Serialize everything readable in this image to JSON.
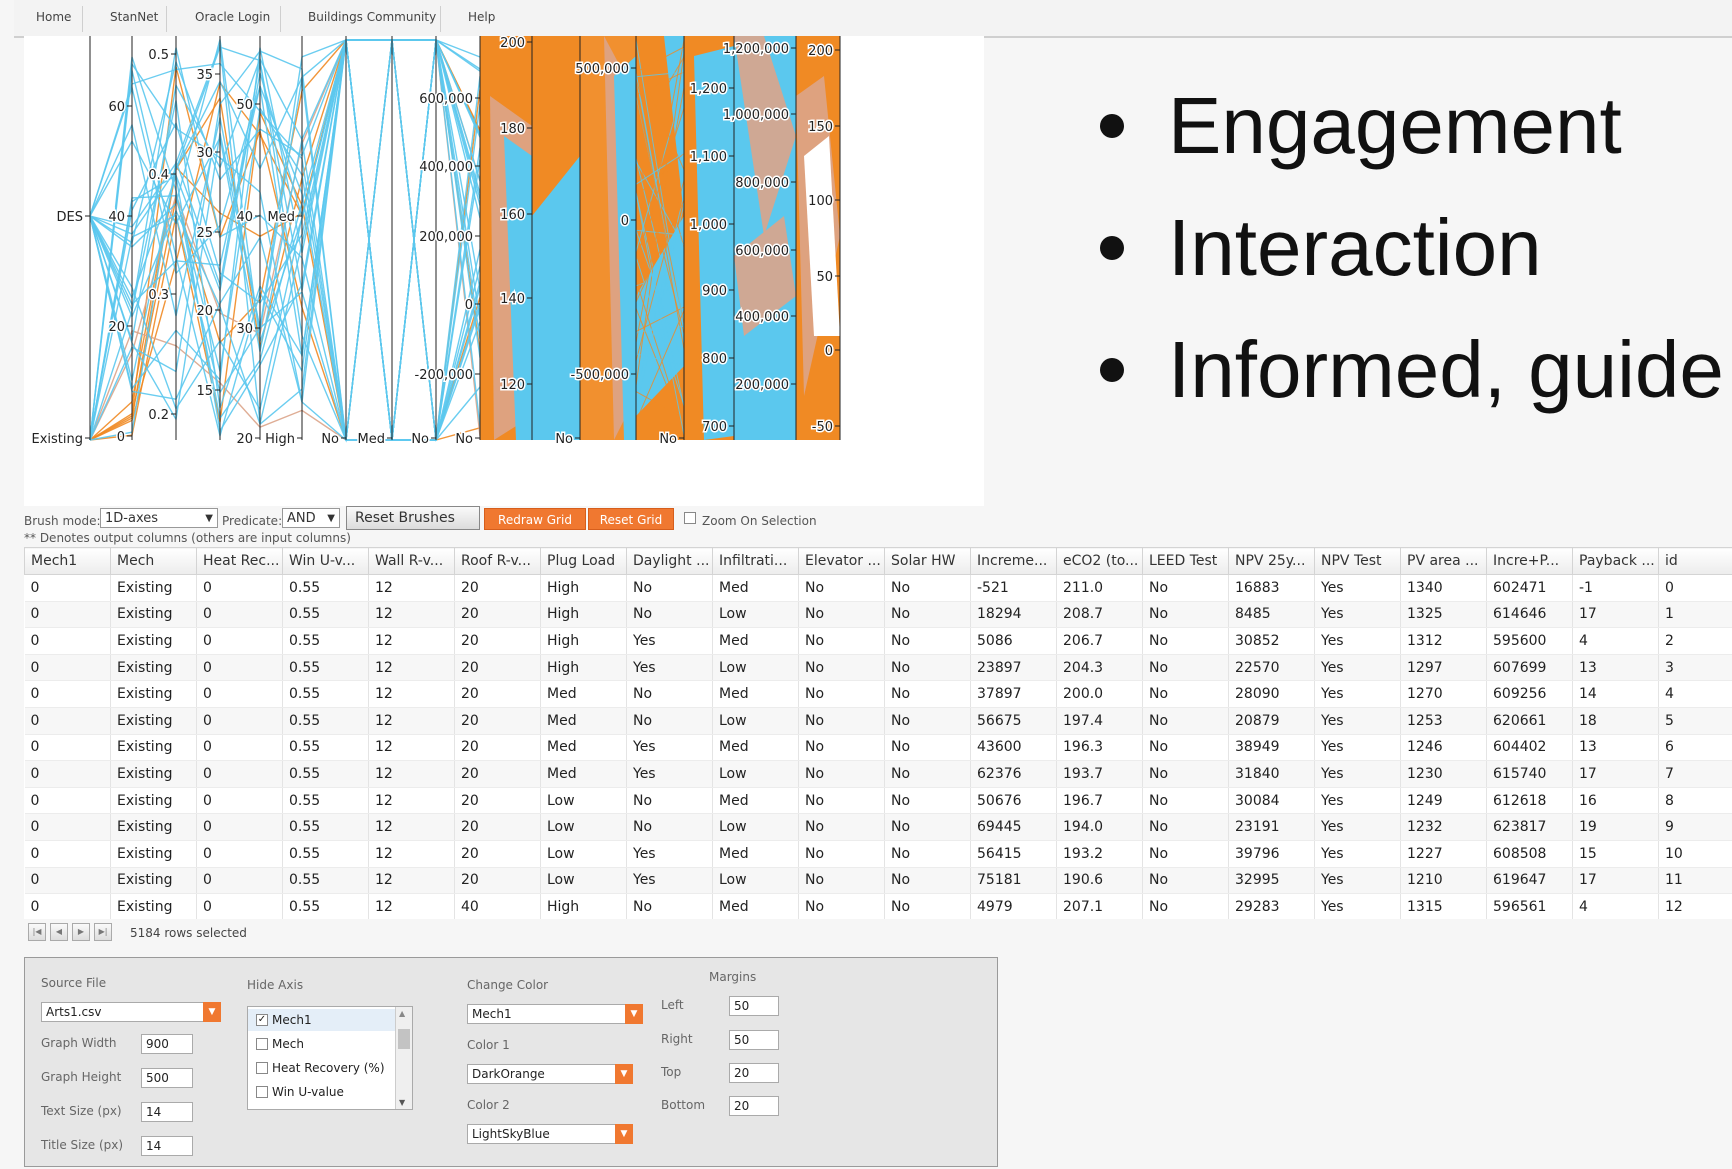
{
  "nav": {
    "items": [
      "Home",
      "StanNet",
      "Oracle Login",
      "Buildings Community",
      "Help"
    ]
  },
  "colors": {
    "orange": "#f08a24",
    "blue": "#5bc8ee",
    "tan": "#dca48a",
    "button_orange": "#f07830"
  },
  "chart": {
    "axes": [
      {
        "ticks": [
          {
            "label": "DES"
          },
          {
            "label": "Existing"
          }
        ]
      },
      {
        "ticks": [
          {
            "label": "60"
          },
          {
            "label": "40"
          },
          {
            "label": "20"
          },
          {
            "label": "0"
          }
        ]
      },
      {
        "ticks": [
          {
            "label": "0.5"
          },
          {
            "label": "0.4"
          },
          {
            "label": "0.3"
          },
          {
            "label": "0.2"
          }
        ]
      },
      {
        "ticks": [
          {
            "label": "35"
          },
          {
            "label": "30"
          },
          {
            "label": "25"
          },
          {
            "label": "20"
          },
          {
            "label": "15"
          }
        ]
      },
      {
        "ticks": [
          {
            "label": "50"
          },
          {
            "label": "40"
          },
          {
            "label": "30"
          },
          {
            "label": "20"
          }
        ]
      },
      {
        "ticks": [
          {
            "label": "Med"
          },
          {
            "label": "High"
          }
        ]
      },
      {
        "ticks": [
          {
            "label": "No"
          }
        ]
      },
      {
        "ticks": [
          {
            "label": "Med"
          }
        ]
      },
      {
        "ticks": [
          {
            "label": "No"
          }
        ]
      },
      {
        "ticks": [
          {
            "label": "600,000"
          },
          {
            "label": "400,000"
          },
          {
            "label": "200,000"
          },
          {
            "label": "0"
          },
          {
            "label": "-200,000"
          },
          {
            "label": "No"
          }
        ]
      },
      {
        "ticks": [
          {
            "label": "200"
          },
          {
            "label": "180"
          },
          {
            "label": "160"
          },
          {
            "label": "140"
          },
          {
            "label": "120"
          }
        ]
      },
      {
        "ticks": [
          {
            "label": "No"
          }
        ]
      },
      {
        "ticks": [
          {
            "label": "500,000"
          },
          {
            "label": "0"
          },
          {
            "label": "-500,000"
          }
        ]
      },
      {
        "ticks": [
          {
            "label": "No"
          }
        ]
      },
      {
        "ticks": [
          {
            "label": "1,200"
          },
          {
            "label": "1,100"
          },
          {
            "label": "1,000"
          },
          {
            "label": "900"
          },
          {
            "label": "800"
          },
          {
            "label": "700"
          }
        ]
      },
      {
        "ticks": [
          {
            "label": "1,200,000"
          },
          {
            "label": "1,000,000"
          },
          {
            "label": "800,000"
          },
          {
            "label": "600,000"
          },
          {
            "label": "400,000"
          },
          {
            "label": "200,000"
          }
        ]
      },
      {
        "ticks": [
          {
            "label": "200"
          },
          {
            "label": "150"
          },
          {
            "label": "100"
          },
          {
            "label": "50"
          },
          {
            "label": "0"
          },
          {
            "label": "-50"
          }
        ]
      }
    ]
  },
  "bullets": [
    "Engagement",
    "Interaction",
    "Informed, guide"
  ],
  "toolbar": {
    "brush_mode_label": "Brush mode:",
    "brush_mode_value": "1D-axes",
    "predicate_label": "Predicate:",
    "predicate_value": "AND",
    "reset_brushes": "Reset Brushes",
    "redraw_grid": "Redraw Grid",
    "reset_grid": "Reset Grid",
    "zoom_on_selection": "Zoom On Selection"
  },
  "note": "** Denotes output columns (others are input columns)",
  "grid": {
    "columns": [
      "Mech1",
      "Mech",
      "Heat Rec...",
      "Win U-v...",
      "Wall R-v...",
      "Roof R-v...",
      "Plug Load",
      "Daylight ...",
      "Infiltrati...",
      "Elevator ...",
      "Solar HW",
      "Increme...",
      "eCO2 (to...",
      "LEED Test",
      "NPV 25y...",
      "NPV Test",
      "PV area ...",
      "Incre+P...",
      "Payback ...",
      "id"
    ],
    "rows": [
      [
        "0",
        "Existing",
        "0",
        "0.55",
        "12",
        "20",
        "High",
        "No",
        "Med",
        "No",
        "No",
        "-521",
        "211.0",
        "No",
        "16883",
        "Yes",
        "1340",
        "602471",
        "-1",
        "0"
      ],
      [
        "0",
        "Existing",
        "0",
        "0.55",
        "12",
        "20",
        "High",
        "No",
        "Low",
        "No",
        "No",
        "18294",
        "208.7",
        "No",
        "8485",
        "Yes",
        "1325",
        "614646",
        "17",
        "1"
      ],
      [
        "0",
        "Existing",
        "0",
        "0.55",
        "12",
        "20",
        "High",
        "Yes",
        "Med",
        "No",
        "No",
        "5086",
        "206.7",
        "No",
        "30852",
        "Yes",
        "1312",
        "595600",
        "4",
        "2"
      ],
      [
        "0",
        "Existing",
        "0",
        "0.55",
        "12",
        "20",
        "High",
        "Yes",
        "Low",
        "No",
        "No",
        "23897",
        "204.3",
        "No",
        "22570",
        "Yes",
        "1297",
        "607699",
        "13",
        "3"
      ],
      [
        "0",
        "Existing",
        "0",
        "0.55",
        "12",
        "20",
        "Med",
        "No",
        "Med",
        "No",
        "No",
        "37897",
        "200.0",
        "No",
        "28090",
        "Yes",
        "1270",
        "609256",
        "14",
        "4"
      ],
      [
        "0",
        "Existing",
        "0",
        "0.55",
        "12",
        "20",
        "Med",
        "No",
        "Low",
        "No",
        "No",
        "56675",
        "197.4",
        "No",
        "20879",
        "Yes",
        "1253",
        "620661",
        "18",
        "5"
      ],
      [
        "0",
        "Existing",
        "0",
        "0.55",
        "12",
        "20",
        "Med",
        "Yes",
        "Med",
        "No",
        "No",
        "43600",
        "196.3",
        "No",
        "38949",
        "Yes",
        "1246",
        "604402",
        "13",
        "6"
      ],
      [
        "0",
        "Existing",
        "0",
        "0.55",
        "12",
        "20",
        "Med",
        "Yes",
        "Low",
        "No",
        "No",
        "62376",
        "193.7",
        "No",
        "31840",
        "Yes",
        "1230",
        "615740",
        "17",
        "7"
      ],
      [
        "0",
        "Existing",
        "0",
        "0.55",
        "12",
        "20",
        "Low",
        "No",
        "Med",
        "No",
        "No",
        "50676",
        "196.7",
        "No",
        "30084",
        "Yes",
        "1249",
        "612618",
        "16",
        "8"
      ],
      [
        "0",
        "Existing",
        "0",
        "0.55",
        "12",
        "20",
        "Low",
        "No",
        "Low",
        "No",
        "No",
        "69445",
        "194.0",
        "No",
        "23191",
        "Yes",
        "1232",
        "623817",
        "19",
        "9"
      ],
      [
        "0",
        "Existing",
        "0",
        "0.55",
        "12",
        "20",
        "Low",
        "Yes",
        "Med",
        "No",
        "No",
        "56415",
        "193.2",
        "No",
        "39796",
        "Yes",
        "1227",
        "608508",
        "15",
        "10"
      ],
      [
        "0",
        "Existing",
        "0",
        "0.55",
        "12",
        "20",
        "Low",
        "Yes",
        "Low",
        "No",
        "No",
        "75181",
        "190.6",
        "No",
        "32995",
        "Yes",
        "1210",
        "619647",
        "17",
        "11"
      ],
      [
        "0",
        "Existing",
        "0",
        "0.55",
        "12",
        "40",
        "High",
        "No",
        "Med",
        "No",
        "No",
        "4979",
        "207.1",
        "No",
        "29283",
        "Yes",
        "1315",
        "596561",
        "4",
        "12"
      ]
    ]
  },
  "pager": {
    "status": "5184 rows selected"
  },
  "settings": {
    "source_file_label": "Source File",
    "source_file_value": "Arts1.csv",
    "graph_width_label": "Graph Width",
    "graph_width_value": "900",
    "graph_height_label": "Graph Height",
    "graph_height_value": "500",
    "text_size_label": "Text Size (px)",
    "text_size_value": "14",
    "title_size_label": "Title Size (px)",
    "title_size_value": "14",
    "hide_axis_label": "Hide Axis",
    "hide_axis_items": [
      {
        "label": "Mech1",
        "checked": true
      },
      {
        "label": "Mech",
        "checked": false
      },
      {
        "label": "Heat Recovery (%)",
        "checked": false
      },
      {
        "label": "Win U-value",
        "checked": false
      }
    ],
    "change_color_label": "Change Color",
    "change_color_value": "Mech1",
    "color1_label": "Color 1",
    "color1_value": "DarkOrange",
    "color2_label": "Color 2",
    "color2_value": "LightSkyBlue",
    "margins_label": "Margins",
    "left_label": "Left",
    "left_value": "50",
    "right_label": "Right",
    "right_value": "50",
    "top_label": "Top",
    "top_value": "20",
    "bottom_label": "Bottom",
    "bottom_value": "20"
  }
}
